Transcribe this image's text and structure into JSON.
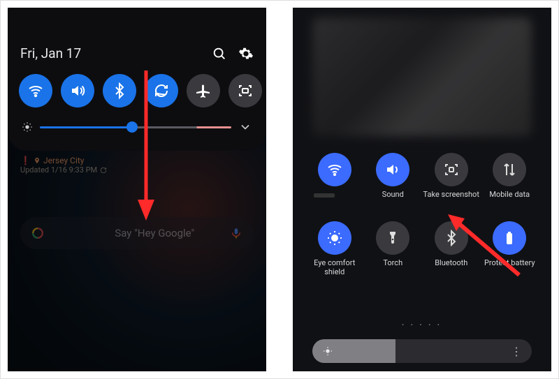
{
  "left": {
    "date": "Fri, Jan 17",
    "brightness_percent": 48,
    "tiles": [
      {
        "name": "wifi",
        "on": true
      },
      {
        "name": "sound",
        "on": true
      },
      {
        "name": "bluetooth",
        "on": true
      },
      {
        "name": "sync",
        "on": true
      },
      {
        "name": "airplane",
        "on": false
      },
      {
        "name": "screenshot",
        "on": false
      }
    ],
    "weather": {
      "location": "Jersey City",
      "updated": "Updated 1/16 9:33 PM"
    },
    "search_placeholder": "Say \"Hey Google\""
  },
  "right": {
    "tiles": [
      {
        "name": "wifi",
        "label": "",
        "on": true
      },
      {
        "name": "sound",
        "label": "Sound",
        "on": true
      },
      {
        "name": "screenshot",
        "label": "Take screenshot",
        "on": false
      },
      {
        "name": "mobile-data",
        "label": "Mobile data",
        "on": false
      },
      {
        "name": "eye-comfort",
        "label": "Eye comfort shield",
        "on": true
      },
      {
        "name": "torch",
        "label": "Torch",
        "on": false
      },
      {
        "name": "bluetooth",
        "label": "Bluetooth",
        "on": false
      },
      {
        "name": "protect-battery",
        "label": "Protect battery",
        "on": true
      }
    ],
    "page_indicator": "•  • • • •",
    "brightness_percent": 38
  },
  "colors": {
    "accent_left": "#1a73e8",
    "accent_right": "#3b6bff",
    "arrow": "#ff2a2a"
  }
}
